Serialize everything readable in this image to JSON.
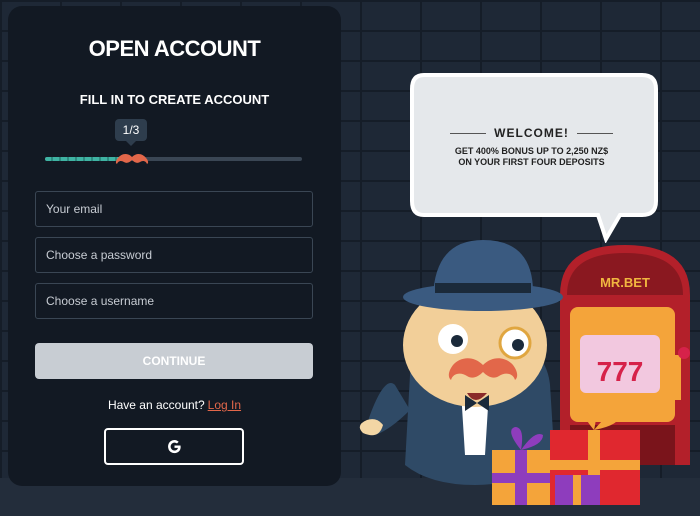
{
  "form": {
    "title": "OPEN ACCOUNT",
    "subtitle": "FILL IN TO CREATE ACCOUNT",
    "step_label": "1/3",
    "progress": 0.33,
    "email_placeholder": "Your email",
    "password_placeholder": "Choose a password",
    "username_placeholder": "Choose a username",
    "continue_label": "CONTINUE",
    "have_account_text": "Have an account?",
    "login_label": "Log In",
    "google_icon": "google-g-icon"
  },
  "promo": {
    "welcome": "WELCOME!",
    "bonus_line1": "GET 400% BONUS UP TO 2,250 NZ$",
    "bonus_line2": "ON YOUR FIRST FOUR DEPOSITS",
    "slot_brand": "MR.BET",
    "slot_reels": "777"
  },
  "colors": {
    "panel": "#121923",
    "accent_teal": "#3fb3a3",
    "link": "#e2674a",
    "button_disabled": "#c8cdd3"
  }
}
